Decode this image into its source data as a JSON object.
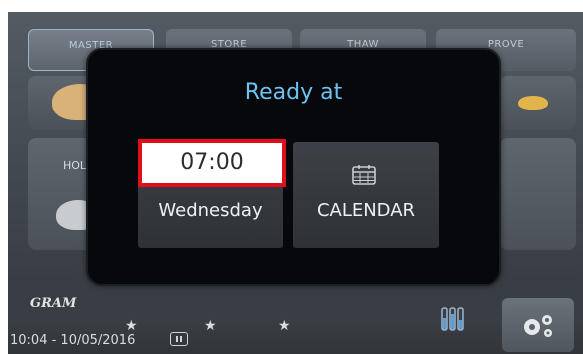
{
  "tabs": [
    "MASTER",
    "STORE",
    "THAW",
    "PROVE"
  ],
  "background_label": "HOL",
  "brand": "GRAM",
  "status": {
    "datetime": "10:04 - 10/05/2016"
  },
  "dialog": {
    "title": "Ready at",
    "time": "07:00",
    "day": "Wednesday",
    "calendar_label": "CALENDAR"
  },
  "icons": {
    "calendar": "calendar-icon",
    "pause": "pause-icon",
    "settings": "gears-icon",
    "levels": "levels-icon",
    "star": "star-icon"
  },
  "colors": {
    "title": "#6ec3f2",
    "highlight": "#e10f1b",
    "dialog_bg": "#06080b"
  }
}
